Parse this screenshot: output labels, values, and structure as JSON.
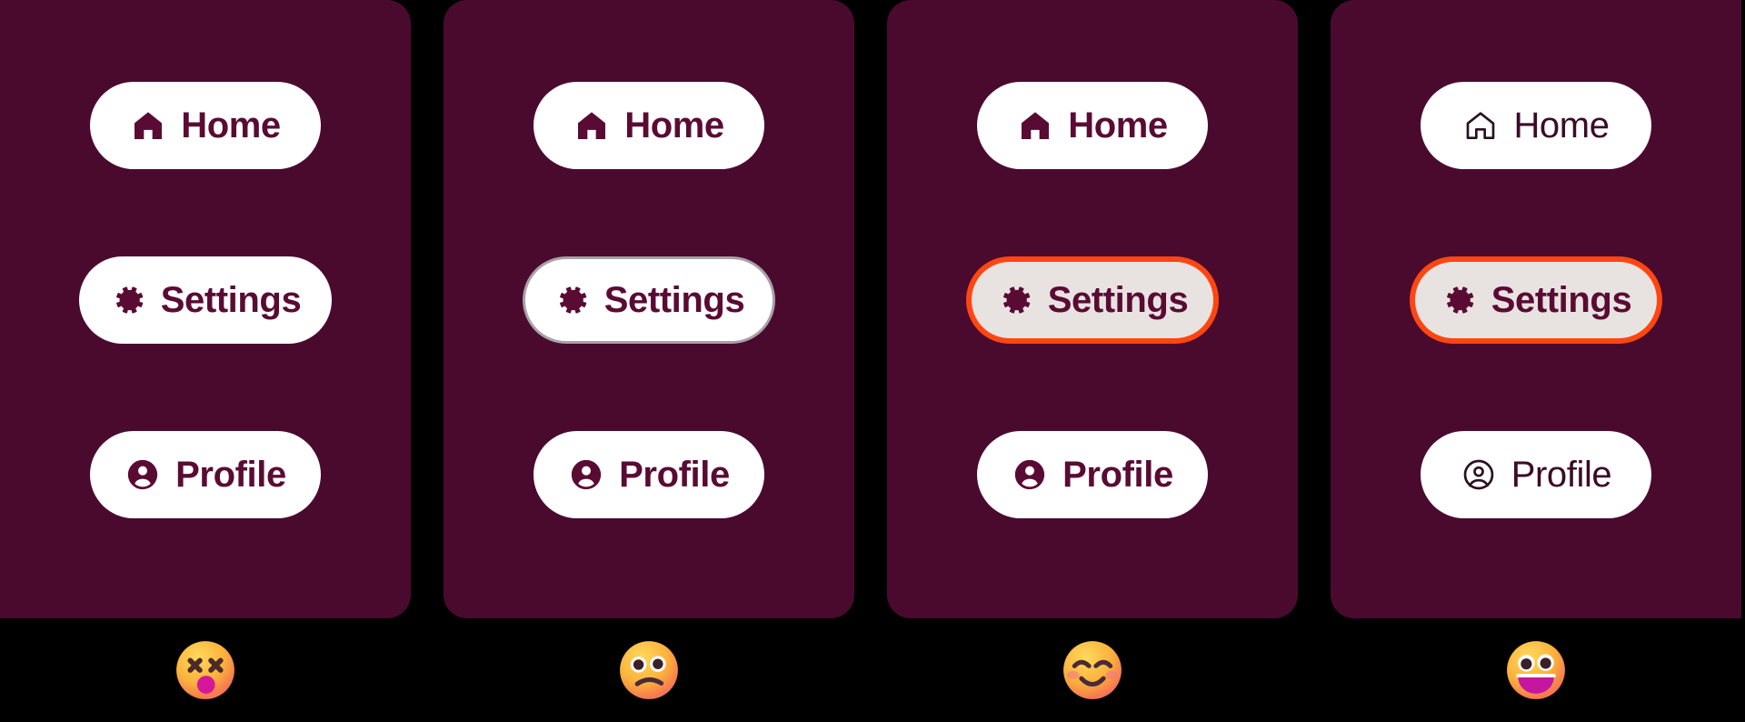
{
  "meta": {
    "background_color": "#000000",
    "panel_color": "#4A0A2E",
    "button_bg": "#FFFFFF",
    "button_text_color": "#5A0B33",
    "focus_ring_color": "#FF4612",
    "focus_fill_color": "#E8E3E1",
    "weak_border_color": "#A9A1A6"
  },
  "panels": [
    {
      "id": "panel-1",
      "focus_style": "none",
      "buttons": [
        {
          "label": "Home",
          "icon": "home-icon",
          "icon_style": "filled",
          "weight": "bold",
          "state": "default"
        },
        {
          "label": "Settings",
          "icon": "gear-icon",
          "icon_style": "filled",
          "weight": "bold",
          "state": "focused-no-indicator"
        },
        {
          "label": "Profile",
          "icon": "profile-icon",
          "icon_style": "filled",
          "weight": "bold",
          "state": "default"
        }
      ],
      "rating": {
        "emoji": "dizzy-face",
        "alt": "dizzy face with x eyes"
      }
    },
    {
      "id": "panel-2",
      "focus_style": "weak-border",
      "buttons": [
        {
          "label": "Home",
          "icon": "home-icon",
          "icon_style": "filled",
          "weight": "bold",
          "state": "default"
        },
        {
          "label": "Settings",
          "icon": "gear-icon",
          "icon_style": "filled",
          "weight": "bold",
          "state": "focused-weak"
        },
        {
          "label": "Profile",
          "icon": "profile-icon",
          "icon_style": "filled",
          "weight": "bold",
          "state": "default"
        }
      ],
      "rating": {
        "emoji": "confused-face",
        "alt": "slightly frowning confused face"
      }
    },
    {
      "id": "panel-3",
      "focus_style": "strong-orange-ring",
      "buttons": [
        {
          "label": "Home",
          "icon": "home-icon",
          "icon_style": "filled",
          "weight": "bold",
          "state": "default"
        },
        {
          "label": "Settings",
          "icon": "gear-icon",
          "icon_style": "filled",
          "weight": "bold",
          "state": "focused-strong"
        },
        {
          "label": "Profile",
          "icon": "profile-icon",
          "icon_style": "filled",
          "weight": "bold",
          "state": "default"
        }
      ],
      "rating": {
        "emoji": "smiling-face",
        "alt": "smiling face with smiling eyes"
      }
    },
    {
      "id": "panel-4",
      "focus_style": "strong-orange-ring-with-deemphasis",
      "buttons": [
        {
          "label": "Home",
          "icon": "home-outline-icon",
          "icon_style": "outline",
          "weight": "regular",
          "state": "default-subtle"
        },
        {
          "label": "Settings",
          "icon": "gear-icon",
          "icon_style": "filled",
          "weight": "bold",
          "state": "focused-strong"
        },
        {
          "label": "Profile",
          "icon": "profile-outline-icon",
          "icon_style": "outline",
          "weight": "regular",
          "state": "default-subtle"
        }
      ],
      "rating": {
        "emoji": "grinning-face",
        "alt": "grinning face with open mouth"
      }
    }
  ]
}
